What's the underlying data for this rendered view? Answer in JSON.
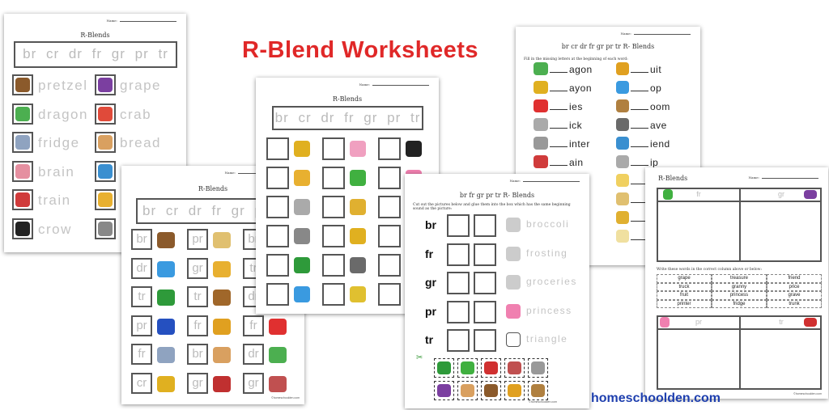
{
  "heading": "R-Blend Worksheets",
  "site": "homeschoolden.com",
  "colors": {
    "heading": "#e02828",
    "site": "#1e3fae"
  },
  "name_label": "Name:",
  "copyright": "©homeschoolden.com",
  "sheet1": {
    "title": "R-Blends",
    "blends": "br cr dr fr gr pr tr",
    "left": [
      {
        "icon": "pretzel",
        "word": "pretzel"
      },
      {
        "icon": "dragon",
        "word": "dragon"
      },
      {
        "icon": "fridge",
        "word": "fridge"
      },
      {
        "icon": "brain",
        "word": "brain"
      },
      {
        "icon": "train",
        "word": "train"
      },
      {
        "icon": "crow",
        "word": "crow"
      }
    ],
    "right": [
      {
        "icon": "grape",
        "word": "grape"
      },
      {
        "icon": "crab",
        "word": "crab"
      },
      {
        "icon": "bread",
        "word": "bread"
      },
      {
        "icon": "friends",
        "word": ""
      },
      {
        "icon": "graph",
        "word": ""
      },
      {
        "icon": "trash-can",
        "word": ""
      }
    ]
  },
  "sheet2": {
    "title": "R-Blends",
    "blends": "br cr dr fr gr pr tr",
    "cols": [
      [
        {
          "b": "br",
          "icon": "bridge"
        },
        {
          "b": "dr",
          "icon": "drop"
        },
        {
          "b": "tr",
          "icon": "tractor"
        },
        {
          "b": "pr",
          "icon": "prize-ribbon"
        },
        {
          "b": "fr",
          "icon": "fridge"
        },
        {
          "b": "cr",
          "icon": "crown"
        }
      ],
      [
        {
          "b": "pr",
          "icon": "price-tag"
        },
        {
          "b": "gr",
          "icon": "graph"
        },
        {
          "b": "tr",
          "icon": "treasure"
        },
        {
          "b": "fr",
          "icon": "fruit"
        },
        {
          "b": "br",
          "icon": "bread"
        },
        {
          "b": "gr",
          "icon": "grill"
        }
      ],
      [
        {
          "b": "br",
          "icon": ""
        },
        {
          "b": "tr",
          "icon": ""
        },
        {
          "b": "dr",
          "icon": ""
        },
        {
          "b": "fr",
          "icon": "fries"
        },
        {
          "b": "dr",
          "icon": "dragon"
        },
        {
          "b": "gr",
          "icon": "granny"
        }
      ]
    ]
  },
  "sheet3": {
    "title": "R-Blends",
    "blends": "br cr dr fr gr pr tr",
    "cols": [
      [
        "crayons",
        "graph",
        "brick",
        "trash-can",
        "tractor",
        "drop"
      ],
      [
        "drink",
        "frog",
        "drill",
        "crown",
        "grave",
        "frame"
      ],
      [
        "crow",
        "princess",
        "",
        "",
        "",
        ""
      ]
    ]
  },
  "sheet4": {
    "title": "br cr dr fr gr pr tr R- Blends",
    "instruction": "Fill in the missing letters at the beginning of each word:",
    "left": [
      {
        "icon": "dragon",
        "end": "agon"
      },
      {
        "icon": "crayons",
        "end": "ayon"
      },
      {
        "icon": "fries",
        "end": "ies"
      },
      {
        "icon": "brick",
        "end": "ick"
      },
      {
        "icon": "printer",
        "end": "inter"
      },
      {
        "icon": "train",
        "end": "ain"
      }
    ],
    "right": [
      {
        "icon": "fruit",
        "end": "uit"
      },
      {
        "icon": "drop",
        "end": "op"
      },
      {
        "icon": "broom",
        "end": "oom"
      },
      {
        "icon": "grave",
        "end": "ave"
      },
      {
        "icon": "friends",
        "end": "iend"
      },
      {
        "icon": "drip",
        "end": "ip"
      },
      {
        "icon": "braid",
        "end": ""
      },
      {
        "icon": "price-tag",
        "end": ""
      },
      {
        "icon": "trumpet",
        "end": ""
      },
      {
        "icon": "clock",
        "end": ""
      }
    ],
    "partial": [
      "h",
      "n",
      "s"
    ]
  },
  "sheet5": {
    "title": "br fr gr pr tr R- Blends",
    "instruction": "Cut out the pictures below and glue them into the box which has the same beginning sound as the picture:",
    "rows": [
      {
        "b": "br",
        "icon": "broccoli",
        "word": "broccoli"
      },
      {
        "b": "fr",
        "icon": "frosting",
        "word": "frosting"
      },
      {
        "b": "gr",
        "icon": "groceries",
        "word": "groceries"
      },
      {
        "b": "pr",
        "icon": "princess",
        "word": "princess"
      },
      {
        "b": "tr",
        "icon": "triangle",
        "word": "triangle"
      }
    ],
    "cutouts": [
      "tractor",
      "frog",
      "truck",
      "granny",
      "printer",
      "grape",
      "bread",
      "pretzel",
      "fruit",
      "broom"
    ]
  },
  "sheet6": {
    "title": "R-Blends",
    "top": [
      "fr",
      "gr"
    ],
    "bottom": [
      "pr",
      "tr"
    ],
    "instruction": "Write these words in the correct column above or below:",
    "words": [
      [
        "grape",
        "treasure",
        "friend"
      ],
      [
        "truck",
        "granny",
        "price"
      ],
      [
        "fruit",
        "princess",
        "grave"
      ],
      [
        "printer",
        "fridge",
        "trunk"
      ]
    ]
  },
  "icon_colors": {
    "pretzel": "#8b5a2b",
    "dragon": "#4caf50",
    "fridge": "#8fa3c0",
    "brain": "#e58fa0",
    "train": "#d03b3b",
    "crow": "#222",
    "grape": "#7b3fa0",
    "crab": "#e04a3a",
    "bread": "#d9a060",
    "friends": "#3a8fd0",
    "graph": "#e8b030",
    "trash-can": "#888",
    "bridge": "#8b5a2b",
    "drop": "#3a9ae0",
    "tractor": "#2e9a3a",
    "prize-ribbon": "#2550c0",
    "crown": "#e0b020",
    "price-tag": "#e0c070",
    "treasure": "#a0672a",
    "fruit": "#e0a020",
    "grill": "#c03030",
    "fries": "#e03030",
    "granny": "#c05050",
    "crayons": "#e0b020",
    "drink": "#f0a0c0",
    "frog": "#40b040",
    "drill": "#e0b030",
    "grave": "#6a6a6a",
    "frame": "#e0c030",
    "princess": "#f080b0",
    "printer": "#999",
    "broom": "#b08040",
    "drip": "#aaa",
    "braid": "#f0d060",
    "trumpet": "#e0b030",
    "clock": "#f0e0a0",
    "broccoli": "#ccc",
    "frosting": "#ccc",
    "groceries": "#ccc",
    "triangle": "#fff",
    "truck": "#d03030"
  }
}
